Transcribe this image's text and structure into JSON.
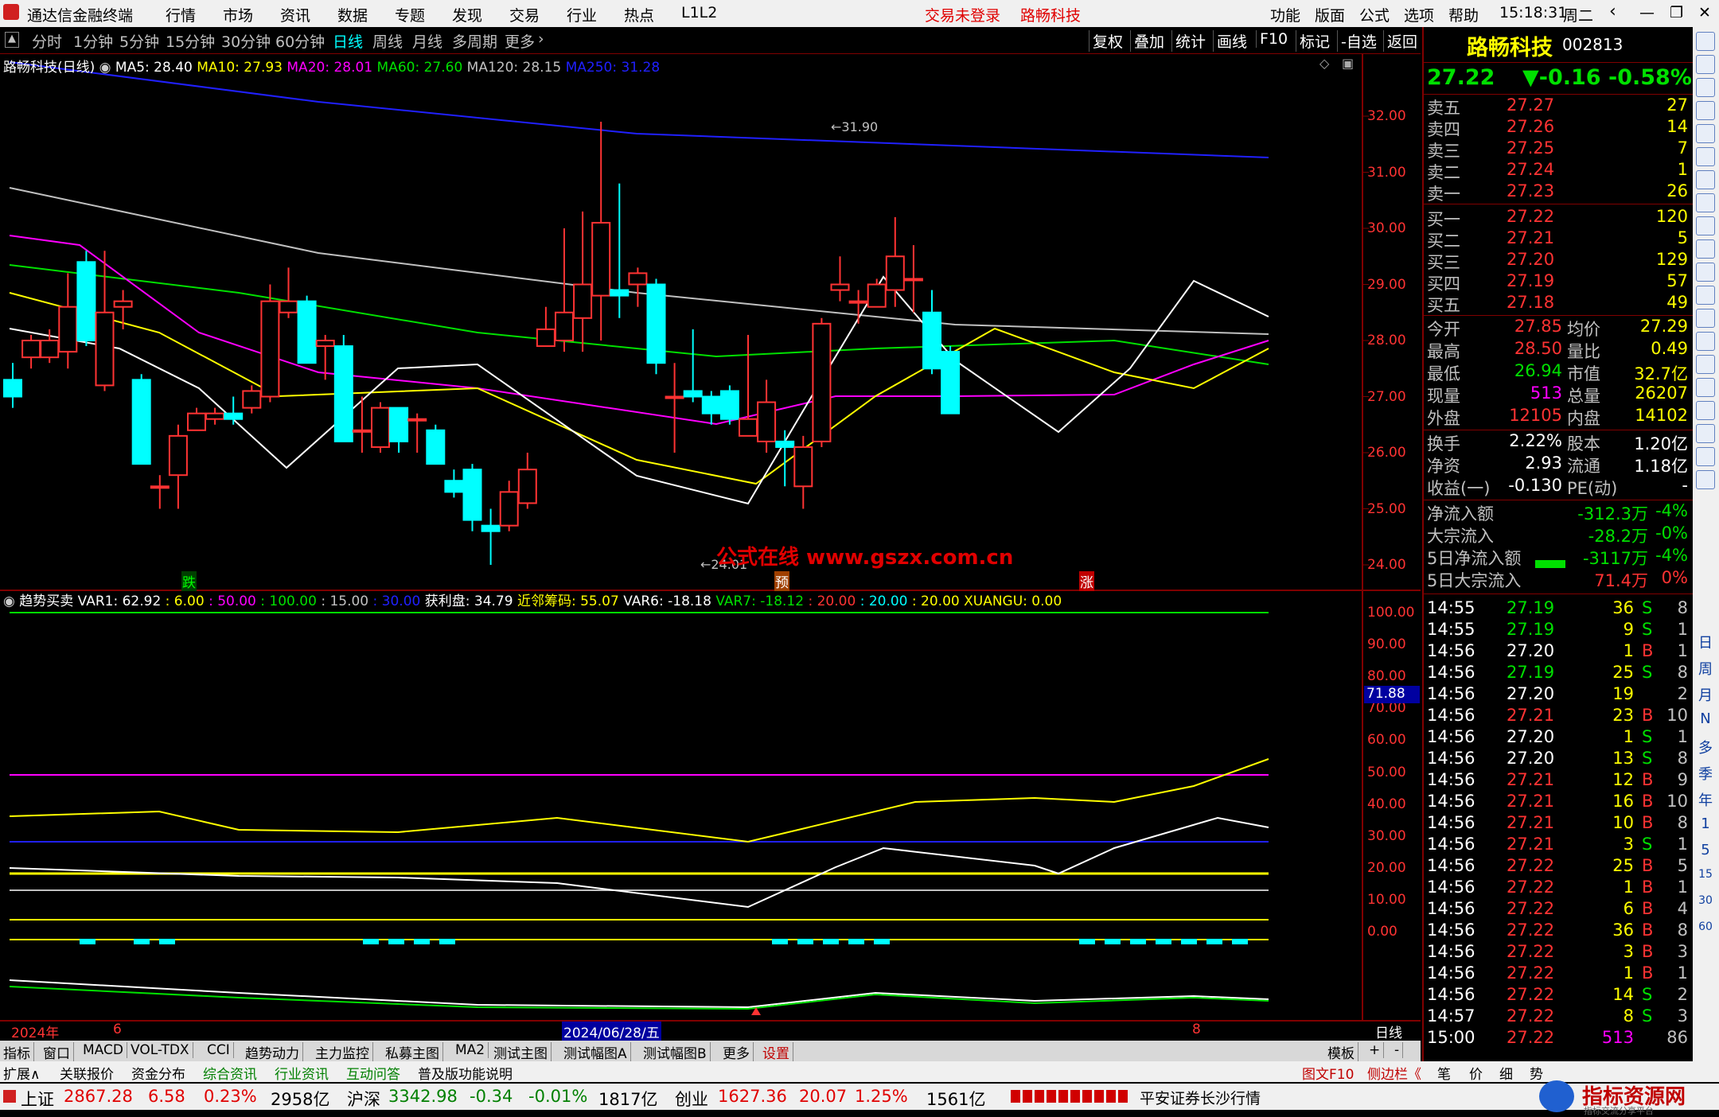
{
  "title": {
    "app": "通达信金融终端",
    "menus": [
      "行情",
      "市场",
      "资讯",
      "数据",
      "专题",
      "发现",
      "交易",
      "行业",
      "热点",
      "L1L2"
    ],
    "trade_status": "交易未登录",
    "stock_name": "路畅科技",
    "right_menus": [
      "功能",
      "版面",
      "公式",
      "选项",
      "帮助"
    ],
    "time": "15:18:31",
    "weekday": "周二"
  },
  "periods": [
    "分时",
    "1分钟",
    "5分钟",
    "15分钟",
    "30分钟",
    "60分钟",
    "日线",
    "周线",
    "月线",
    "多周期",
    "更多"
  ],
  "active_period": "日线",
  "chart_tools": [
    "复权",
    "叠加",
    "统计",
    "画线",
    "F10",
    "标记",
    "-自选",
    "返回"
  ],
  "ma_legend": {
    "name": "路畅科技(日线)",
    "ma5": "MA5: 28.40",
    "ma10": "MA10: 27.93",
    "ma20": "MA20: 28.01",
    "ma60": "MA60: 27.60",
    "ma120": "MA120: 28.15",
    "ma250": "MA250: 31.28"
  },
  "price_axis": [
    "32.00",
    "31.00",
    "30.00",
    "29.00",
    "28.00",
    "27.00",
    "26.00",
    "25.00",
    "24.00"
  ],
  "high_mark": "31.90",
  "low_mark": "24.01",
  "markers": {
    "die": "跌",
    "yu": "预",
    "zhang": "涨"
  },
  "watermark": "公式在线 www.gszx.com.cn",
  "indicator_legend": [
    "趋势买卖",
    "VAR1: 62.92",
    ": 6.00",
    ": 50.00",
    ": 100.00",
    ": 15.00",
    ": 30.00",
    "获利盘: 34.79",
    "近邻筹码: 55.07",
    "VAR6: -18.18",
    "VAR7: -18.12",
    ": 20.00",
    ": 20.00",
    ": 20.00",
    "XUANGU: 0.00"
  ],
  "ind_axis": [
    "100.00",
    "90.00",
    "80.00",
    "70.00",
    "60.00",
    "50.00",
    "40.00",
    "30.00",
    "20.00",
    "10.00",
    "0.00"
  ],
  "ind_current": "71.88",
  "date_axis": {
    "year": "2024年",
    "m6": "6",
    "cursor": "2024/06/28/五",
    "m8": "8",
    "period": "日线"
  },
  "quote": {
    "name": "路畅科技",
    "code": "002813",
    "price": "27.22",
    "change": "▼-0.16",
    "pct": "-0.58%",
    "asks": [
      [
        "卖五",
        "27.27",
        "27"
      ],
      [
        "卖四",
        "27.26",
        "14"
      ],
      [
        "卖三",
        "27.25",
        "7"
      ],
      [
        "卖二",
        "27.24",
        "1"
      ],
      [
        "卖一",
        "27.23",
        "26"
      ]
    ],
    "bids": [
      [
        "买一",
        "27.22",
        "120"
      ],
      [
        "买二",
        "27.21",
        "5"
      ],
      [
        "买三",
        "27.20",
        "129"
      ],
      [
        "买四",
        "27.19",
        "57"
      ],
      [
        "买五",
        "27.18",
        "49"
      ]
    ],
    "stats": [
      [
        "今开",
        "27.85",
        "均价",
        "27.29"
      ],
      [
        "最高",
        "28.50",
        "量比",
        "0.49"
      ],
      [
        "最低",
        "26.94",
        "市值",
        "32.7亿"
      ],
      [
        "现量",
        "513",
        "总量",
        "26207"
      ],
      [
        "外盘",
        "12105",
        "内盘",
        "14102"
      ]
    ],
    "stats2": [
      [
        "换手",
        "2.22%",
        "股本",
        "1.20亿"
      ],
      [
        "净资",
        "2.93",
        "流通",
        "1.18亿"
      ],
      [
        "收益(一)",
        "-0.130",
        "PE(动)",
        "-"
      ]
    ],
    "flows": [
      [
        "净流入额",
        "-312.3万",
        "-4%"
      ],
      [
        "大宗流入",
        "-28.2万",
        "-0%"
      ],
      [
        "5日净流入额",
        "-3117万",
        "-4%"
      ],
      [
        "5日大宗流入",
        "71.4万",
        "0%"
      ]
    ],
    "ticks": [
      [
        "14:55",
        "27.19",
        "36",
        "S",
        "8"
      ],
      [
        "14:55",
        "27.19",
        "9",
        "S",
        "1"
      ],
      [
        "14:56",
        "27.20",
        "1",
        "B",
        "1"
      ],
      [
        "14:56",
        "27.19",
        "25",
        "S",
        "8"
      ],
      [
        "14:56",
        "27.20",
        "19",
        "",
        "2"
      ],
      [
        "14:56",
        "27.21",
        "23",
        "B",
        "10"
      ],
      [
        "14:56",
        "27.20",
        "1",
        "S",
        "1"
      ],
      [
        "14:56",
        "27.20",
        "13",
        "S",
        "8"
      ],
      [
        "14:56",
        "27.21",
        "12",
        "B",
        "9"
      ],
      [
        "14:56",
        "27.21",
        "16",
        "B",
        "10"
      ],
      [
        "14:56",
        "27.21",
        "10",
        "B",
        "8"
      ],
      [
        "14:56",
        "27.21",
        "3",
        "S",
        "1"
      ],
      [
        "14:56",
        "27.22",
        "25",
        "B",
        "5"
      ],
      [
        "14:56",
        "27.22",
        "1",
        "B",
        "1"
      ],
      [
        "14:56",
        "27.22",
        "6",
        "B",
        "4"
      ],
      [
        "14:56",
        "27.22",
        "36",
        "B",
        "8"
      ],
      [
        "14:56",
        "27.22",
        "3",
        "B",
        "3"
      ],
      [
        "14:56",
        "27.22",
        "1",
        "B",
        "1"
      ],
      [
        "14:56",
        "27.22",
        "14",
        "S",
        "2"
      ],
      [
        "14:57",
        "27.22",
        "8",
        "S",
        "3"
      ],
      [
        "15:00",
        "27.22",
        "513",
        "",
        "86"
      ]
    ]
  },
  "right_icons": [
    "日",
    "周",
    "月",
    "N",
    "多",
    "季",
    "年",
    "1",
    "5",
    "15",
    "30",
    "60"
  ],
  "bottom_tabs": [
    "指标",
    "窗口",
    "MACD",
    "VOL-TDX",
    "CCI",
    "趋势动力",
    "主力监控",
    "私募主图",
    "MA2",
    "测试主图",
    "测试幅图A",
    "测试幅图B",
    "更多",
    "设置"
  ],
  "bottom_right": [
    "模板",
    "+",
    "-"
  ],
  "bottom_tabs2": [
    "扩展∧",
    "关联报价",
    "资金分布",
    "综合资讯",
    "行业资讯",
    "互动问答",
    "普及版功能说明"
  ],
  "bottom_tabs2_right": [
    "图文F10",
    "侧边栏《",
    "笔",
    "价",
    "细",
    "势"
  ],
  "status": {
    "sh_name": "上证",
    "sh": "2867.28",
    "sh_chg": "6.58",
    "sh_pct": "0.23%",
    "sh_amt": "2958亿",
    "hs_name": "沪深",
    "hs": "3342.98",
    "hs_chg": "-0.34",
    "hs_pct": "-0.01%",
    "hs_amt": "1817亿",
    "cy_name": "创业",
    "cy": "1627.36",
    "cy_chg": "20.07",
    "cy_pct": "1.25%",
    "cy_amt": "1561亿",
    "broker": "平安证券长沙行情",
    "logo": "指标资源网",
    "logo_sub": "指标交流分享平台"
  },
  "colors": {
    "up": "#ff3333",
    "down": "#00ffff",
    "ma5": "#ffffff",
    "ma10": "#ffff00",
    "ma20": "#ff00ff",
    "ma60": "#00e000",
    "ma120": "#c0c0c0",
    "ma250": "#2020ff"
  }
}
